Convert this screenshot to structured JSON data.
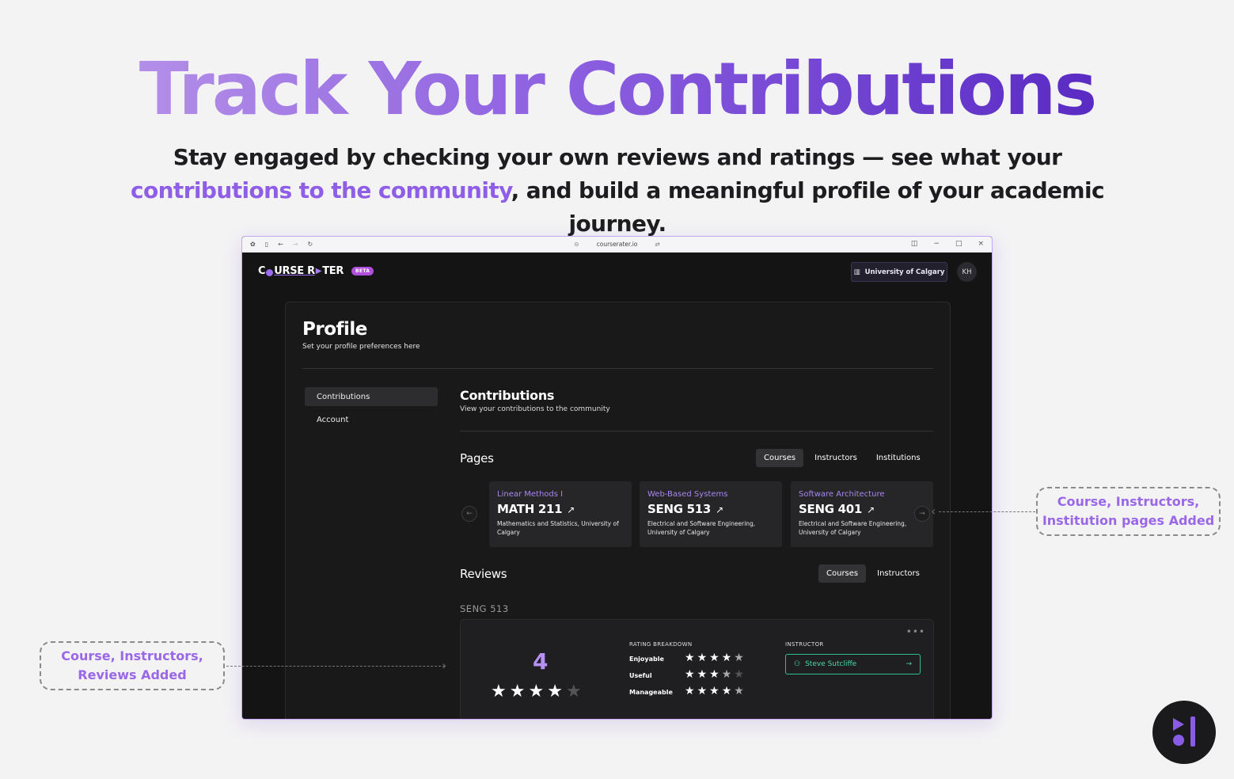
{
  "hero": {
    "title": "Track Your Contributions",
    "sub_part1": "Stay engaged by checking your own reviews and ratings — see what your ",
    "sub_highlight": "contributions to the community",
    "sub_part2": ", and build a meaningful profile of your academic journey."
  },
  "browser": {
    "url": "courserater.io"
  },
  "app": {
    "logo_text": {
      "a": "C",
      "b": "URSE R",
      "c": "TER"
    },
    "beta_badge": "BETA",
    "university": "University of Calgary",
    "avatar_initials": "KH"
  },
  "profile": {
    "title": "Profile",
    "subtitle": "Set your profile preferences here",
    "sidebar": [
      {
        "label": "Contributions",
        "active": true
      },
      {
        "label": "Account",
        "active": false
      }
    ],
    "contributions": {
      "title": "Contributions",
      "subtitle": "View your contributions to the community"
    },
    "pages": {
      "heading": "Pages",
      "tabs": [
        "Courses",
        "Instructors",
        "Institutions"
      ],
      "active_tab": "Courses",
      "cards": [
        {
          "name": "Linear Methods I",
          "code": "MATH 211",
          "faculty": "Mathematics and Statistics, University of Calgary"
        },
        {
          "name": "Web-Based Systems",
          "code": "SENG 513",
          "faculty": "Electrical and Software Engineering, University of Calgary"
        },
        {
          "name": "Software Architecture",
          "code": "SENG 401",
          "faculty": "Electrical and Software Engineering, University of Calgary"
        }
      ]
    },
    "reviews": {
      "heading": "Reviews",
      "tabs": [
        "Courses",
        "Instructors"
      ],
      "active_tab": "Courses",
      "course_label": "SENG 513",
      "overall_score": "4",
      "overall_stars": 4,
      "breakdown_title": "RATING BREAKDOWN",
      "breakdown": [
        {
          "label": "Enjoyable",
          "stars": 4.5
        },
        {
          "label": "Useful",
          "stars": 3.5
        },
        {
          "label": "Manageable",
          "stars": 4.5
        }
      ],
      "instructor_title": "INSTRUCTOR",
      "instructor_name": "Steve Sutcliffe"
    }
  },
  "callouts": {
    "right": {
      "line1": "Course, Instructors,",
      "line2": "Institution pages Added"
    },
    "left": {
      "line1": "Course, Instructors,",
      "line2": "Reviews Added"
    }
  },
  "colors": {
    "accent_purple": "#9a68e6",
    "instructor_green": "#4fd9a3",
    "app_background": "#141414"
  }
}
